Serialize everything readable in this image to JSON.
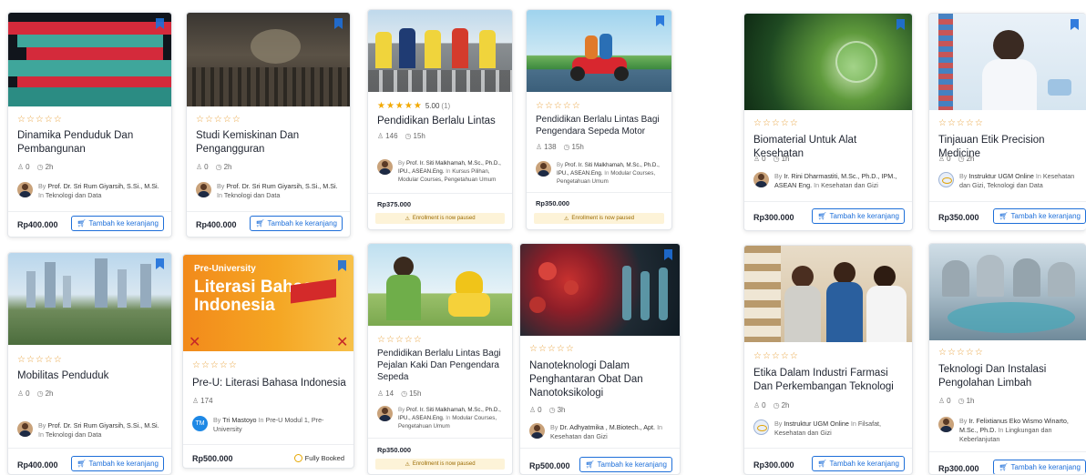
{
  "cart_label": "Tambah ke keranjang",
  "paused_label": "Enrollment is now paused",
  "booked_label": "Fully Booked",
  "by_label": "By",
  "in_label": "In",
  "colors": {
    "accent": "#1e6fd9",
    "star": "#f2a900",
    "warning_bg": "#fdf3d8"
  },
  "courses": [
    {
      "title": "Dinamika Penduduk Dan Pembangunan",
      "students": "0",
      "duration": "2h",
      "instructor": "Prof. Dr. Sri Rum Giyarsih, S.Si., M.Si.",
      "category": "Teknologi dan Data",
      "price": "Rp400.000",
      "avatar": "person",
      "footer": "cart"
    },
    {
      "title": "Studi Kemiskinan Dan Pengangguran",
      "students": "0",
      "duration": "2h",
      "instructor": "Prof. Dr. Sri Rum Giyarsih, S.Si., M.Si.",
      "category": "Teknologi dan Data",
      "price": "Rp400.000",
      "avatar": "person",
      "footer": "cart"
    },
    {
      "title": "Pendidikan Berlalu Lintas",
      "rating": "5.00",
      "rating_count": "(1)",
      "students": "146",
      "duration": "15h",
      "instructor": "Prof. Ir. Siti Malkhamah, M.Sc., Ph.D., IPU., ASEAN.Eng.",
      "category": "Kursus Pilihan, Modular Courses, Pengetahuan Umum",
      "price": "Rp375.000",
      "avatar": "person",
      "footer": "paused"
    },
    {
      "title": "Pendidikan Berlalu Lintas Bagi Pengendara Sepeda Motor",
      "students": "138",
      "duration": "15h",
      "instructor": "Prof. Ir. Siti Malkhamah, M.Sc., Ph.D., IPU., ASEAN.Eng.",
      "category": "Modular Courses, Pengetahuan Umum",
      "price": "Rp350.000",
      "avatar": "person",
      "footer": "paused"
    },
    {
      "title": "Biomaterial Untuk Alat Kesehatan",
      "students": "0",
      "duration": "1h",
      "instructor": "Ir. Rini Dharmastiti, M.Sc., Ph.D., IPM., ASEAN Eng.",
      "category": "Kesehatan dan Gizi",
      "price": "Rp300.000",
      "avatar": "person",
      "footer": "cart"
    },
    {
      "title": "Tinjauan Etik Precision Medicine",
      "students": "0",
      "duration": "2h",
      "instructor": "Instruktur UGM Online",
      "category": "Kesehatan dan Gizi, Teknologi dan Data",
      "price": "Rp350.000",
      "avatar": "ugm",
      "footer": "cart"
    },
    {
      "title": "Mobilitas Penduduk",
      "students": "0",
      "duration": "2h",
      "instructor": "Prof. Dr. Sri Rum Giyarsih, S.Si., M.Si.",
      "category": "Teknologi dan Data",
      "price": "Rp400.000",
      "avatar": "person",
      "footer": "cart"
    },
    {
      "title": "Pre-U: Literasi Bahasa Indonesia",
      "students": "174",
      "instructor": "Tri Mastoyo",
      "category": "Pre-U Modul 1, Pre-University",
      "price": "Rp500.000",
      "avatar": "tm",
      "avatar_initials": "TM",
      "footer": "booked",
      "banner_top": "Pre-University",
      "banner_main": "Literasi Bahasa Indonesia"
    },
    {
      "title": "Pendidikan Berlalu Lintas Bagi Pejalan Kaki Dan Pengendara Sepeda",
      "students": "14",
      "duration": "15h",
      "instructor": "Prof. Ir. Siti Malkhamah, M.Sc., Ph.D., IPU., ASEAN.Eng.",
      "category": "Modular Courses, Pengetahuan Umum",
      "price": "Rp350.000",
      "avatar": "person",
      "footer": "paused"
    },
    {
      "title": "Nanoteknologi Dalam Penghantaran Obat Dan Nanotoksikologi",
      "students": "0",
      "duration": "3h",
      "instructor": "Dr. Adhyatmika , M.Biotech., Apt.",
      "category": "Kesehatan dan Gizi",
      "price": "Rp500.000",
      "avatar": "person",
      "footer": "cart"
    },
    {
      "title": "Etika Dalam Industri Farmasi Dan Perkembangan Teknologi",
      "students": "0",
      "duration": "2h",
      "instructor": "Instruktur UGM Online",
      "category": "Filsafat, Kesehatan dan Gizi",
      "price": "Rp300.000",
      "avatar": "ugm",
      "footer": "cart"
    },
    {
      "title": "Teknologi Dan Instalasi Pengolahan Limbah",
      "students": "0",
      "duration": "1h",
      "instructor": "Ir. Felixtianus Eko Wismo Winarto, M.Sc., Ph.D.",
      "category": "Lingkungan dan Keberlanjutan",
      "price": "Rp300.000",
      "avatar": "person",
      "footer": "cart"
    }
  ]
}
